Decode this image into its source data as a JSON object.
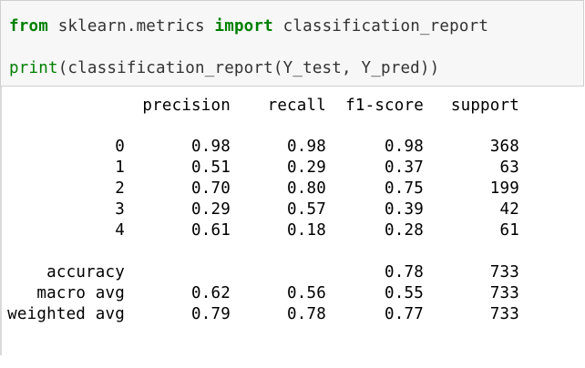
{
  "code": {
    "line1": {
      "kw_from": "from",
      "module": " sklearn.metrics ",
      "kw_import": "import",
      "name": " classification_report"
    },
    "line2": {
      "builtin_print": "print",
      "call": "(classification_report(Y_test, Y_pred))"
    }
  },
  "report": {
    "headers": {
      "precision": "precision",
      "recall": "recall",
      "f1": "f1-score",
      "support": "support"
    },
    "rows": [
      {
        "label": "0",
        "precision": "0.98",
        "recall": "0.98",
        "f1": "0.98",
        "support": "368"
      },
      {
        "label": "1",
        "precision": "0.51",
        "recall": "0.29",
        "f1": "0.37",
        "support": "63"
      },
      {
        "label": "2",
        "precision": "0.70",
        "recall": "0.80",
        "f1": "0.75",
        "support": "199"
      },
      {
        "label": "3",
        "precision": "0.29",
        "recall": "0.57",
        "f1": "0.39",
        "support": "42"
      },
      {
        "label": "4",
        "precision": "0.61",
        "recall": "0.18",
        "f1": "0.28",
        "support": "61"
      }
    ],
    "summary": [
      {
        "label": "accuracy",
        "precision": "",
        "recall": "",
        "f1": "0.78",
        "support": "733"
      },
      {
        "label": "macro avg",
        "precision": "0.62",
        "recall": "0.56",
        "f1": "0.55",
        "support": "733"
      },
      {
        "label": "weighted avg",
        "precision": "0.79",
        "recall": "0.78",
        "f1": "0.77",
        "support": "733"
      }
    ]
  },
  "colors": {
    "keyword": "#008000",
    "input_bg": "#f7f7f7",
    "input_border": "#cfcfcf"
  }
}
